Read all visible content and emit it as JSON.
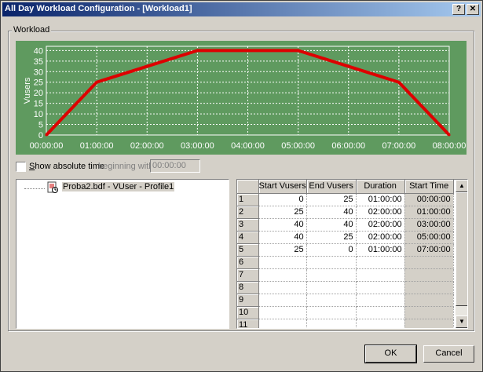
{
  "window": {
    "title": "All Day Workload Configuration - [Workload1]",
    "help_label": "?",
    "close_label": "✕"
  },
  "group": {
    "label": "Workload"
  },
  "chart_data": {
    "type": "line",
    "x": [
      "00:00:00",
      "01:00:00",
      "02:00:00",
      "03:00:00",
      "04:00:00",
      "05:00:00",
      "06:00:00",
      "07:00:00",
      "08:00:00"
    ],
    "series": [
      {
        "values": [
          0,
          25,
          32.5,
          40,
          40,
          40,
          32.5,
          25,
          0
        ]
      }
    ],
    "ylabel": "Vusers",
    "ylim": [
      0,
      42
    ],
    "yticks": [
      0,
      5,
      10,
      15,
      20,
      25,
      30,
      35,
      40
    ],
    "grid": true,
    "background": "#5f9a5f",
    "line_color": "#dd0000"
  },
  "options": {
    "show_absolute_label_prefix": "S",
    "show_absolute_label_rest": "how absolute time",
    "beginning_label": "beginning with",
    "beginning_value": "00:00:00"
  },
  "tree": {
    "item_label": "Proba2.bdf - VUser - Profile1"
  },
  "grid": {
    "headers": [
      "Start Vusers",
      "End Vusers",
      "Duration",
      "Start Time"
    ],
    "rows": [
      {
        "n": "1",
        "start": "0",
        "end": "25",
        "duration": "01:00:00",
        "start_time": "00:00:00"
      },
      {
        "n": "2",
        "start": "25",
        "end": "40",
        "duration": "02:00:00",
        "start_time": "01:00:00"
      },
      {
        "n": "3",
        "start": "40",
        "end": "40",
        "duration": "02:00:00",
        "start_time": "03:00:00"
      },
      {
        "n": "4",
        "start": "40",
        "end": "25",
        "duration": "02:00:00",
        "start_time": "05:00:00"
      },
      {
        "n": "5",
        "start": "25",
        "end": "0",
        "duration": "01:00:00",
        "start_time": "07:00:00"
      },
      {
        "n": "6",
        "start": "",
        "end": "",
        "duration": "",
        "start_time": ""
      },
      {
        "n": "7",
        "start": "",
        "end": "",
        "duration": "",
        "start_time": ""
      },
      {
        "n": "8",
        "start": "",
        "end": "",
        "duration": "",
        "start_time": ""
      },
      {
        "n": "9",
        "start": "",
        "end": "",
        "duration": "",
        "start_time": ""
      },
      {
        "n": "10",
        "start": "",
        "end": "",
        "duration": "",
        "start_time": ""
      },
      {
        "n": "11",
        "start": "",
        "end": "",
        "duration": "",
        "start_time": ""
      }
    ]
  },
  "buttons": {
    "ok_label": "OK",
    "cancel_label": "Cancel"
  }
}
